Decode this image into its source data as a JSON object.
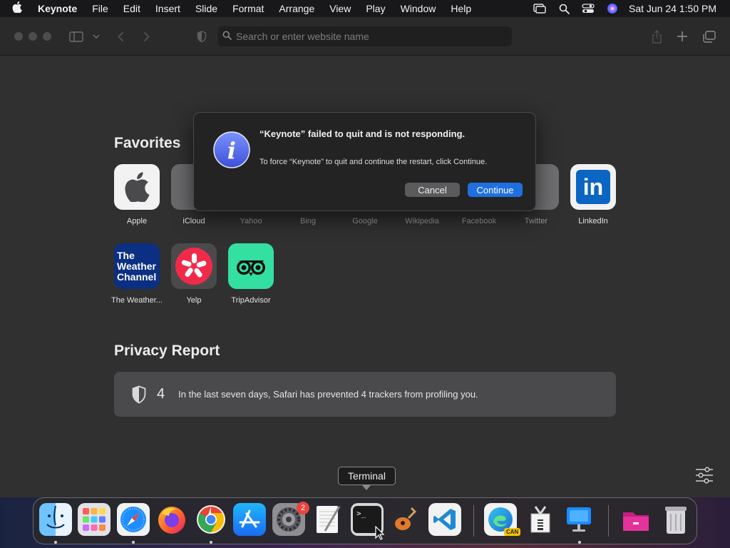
{
  "menubar": {
    "app_name": "Keynote",
    "items": [
      "File",
      "Edit",
      "Insert",
      "Slide",
      "Format",
      "Arrange",
      "View",
      "Play",
      "Window",
      "Help"
    ],
    "clock": "Sat Jun 24  1:50 PM"
  },
  "safari": {
    "address_placeholder": "Search or enter website name",
    "favorites_title": "Favorites",
    "favorites": [
      {
        "label": "Apple",
        "icon": "apple-logo-icon"
      },
      {
        "label": "iCloud",
        "icon": "icloud-icon"
      },
      {
        "label": "Yahoo",
        "icon": "yahoo-icon"
      },
      {
        "label": "Bing",
        "icon": "bing-icon"
      },
      {
        "label": "Google",
        "icon": "google-icon"
      },
      {
        "label": "Wikipedia",
        "icon": "wikipedia-icon"
      },
      {
        "label": "Facebook",
        "icon": "facebook-icon"
      },
      {
        "label": "Twitter",
        "icon": "twitter-icon"
      },
      {
        "label": "LinkedIn",
        "icon": "linkedin-icon",
        "tile_text": "in"
      },
      {
        "label": "The Weather...",
        "icon": "weather-channel-icon",
        "tile_text": "The Weather Channel"
      },
      {
        "label": "Yelp",
        "icon": "yelp-icon"
      },
      {
        "label": "TripAdvisor",
        "icon": "tripadvisor-icon"
      }
    ],
    "privacy_title": "Privacy Report",
    "privacy_count": "4",
    "privacy_text": "In the last seven days, Safari has prevented 4 trackers from profiling you."
  },
  "dialog": {
    "title": "“Keynote” failed to quit and is not responding.",
    "message": "To force “Keynote” to quit and continue the restart, click Continue.",
    "cancel_label": "Cancel",
    "continue_label": "Continue"
  },
  "tooltip": "Terminal",
  "dock": {
    "apps": [
      "Finder",
      "Launchpad",
      "Safari",
      "Firefox",
      "Chrome",
      "App Store",
      "System Settings",
      "TextEdit",
      "Terminal",
      "GarageBand",
      "Visual Studio Code",
      "Microsoft Edge Canary",
      "Archive Utility",
      "Keynote",
      "Pink Folder",
      "Trash"
    ],
    "settings_badge": "2",
    "edge_badge": "CAN"
  },
  "colors": {
    "accent": "#1f6fe0",
    "badge": "#e8453c"
  }
}
